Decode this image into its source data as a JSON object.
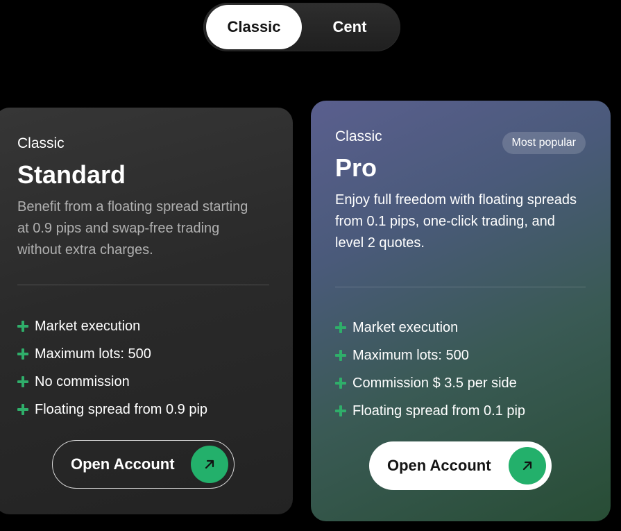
{
  "toggle": {
    "options": [
      "Classic",
      "Cent"
    ],
    "selected": "Classic"
  },
  "cards": [
    {
      "tier": "Classic",
      "title": "Standard",
      "description": "Benefit from a floating spread starting at 0.9 pips and swap-free trading without extra charges.",
      "features": [
        "Market execution",
        "Maximum lots: 500",
        "No commission",
        "Floating spread from 0.9 pip"
      ],
      "cta_label": "Open Account"
    },
    {
      "tier": "Classic",
      "title": "Pro",
      "badge": "Most popular",
      "description": "Enjoy full freedom with floating spreads from 0.1 pips, one-click trading, and level 2 quotes.",
      "features": [
        "Market execution",
        "Maximum lots: 500",
        "Commission $ 3.5 per side",
        "Floating spread from 0.1 pip"
      ],
      "cta_label": "Open Account"
    }
  ],
  "colors": {
    "accent_green": "#23b06b",
    "page_background": "#000000"
  },
  "icons": {
    "feature": "plus-icon",
    "cta": "arrow-up-right-icon"
  }
}
